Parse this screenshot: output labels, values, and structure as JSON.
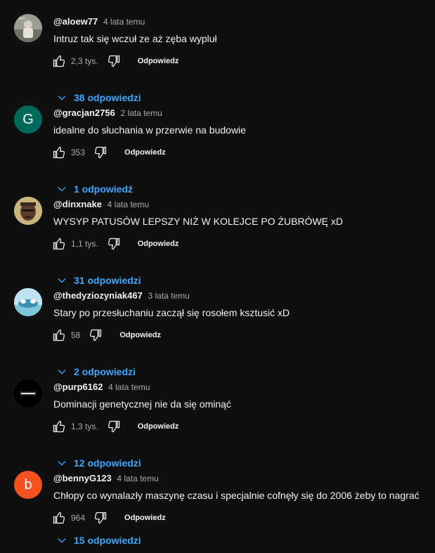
{
  "comments": [
    {
      "author": "@aloew77",
      "time": "4 lata temu",
      "text": "Intruz tak się wczuł ze aż zęba wypluł",
      "likes": "2,3 tys.",
      "reply_label": "Odpowiedz",
      "replies_label": "38 odpowiedzi",
      "avatar": {
        "type": "photo",
        "bg": "#8a8a7a"
      }
    },
    {
      "author": "@gracjan2756",
      "time": "2 lata temu",
      "text": "idealne do słuchania w przerwie na budowie",
      "likes": "353",
      "reply_label": "Odpowiedz",
      "replies_label": "1 odpowiedź",
      "avatar": {
        "type": "letter",
        "letter": "G",
        "bg": "#00695c"
      }
    },
    {
      "author": "@dinxnake",
      "time": "4 lata temu",
      "text": "WYSYP PATUSÓW LEPSZY NIŻ W KOLEJCE PO ŻUBRÓWĘ xD",
      "likes": "1,1 tys.",
      "reply_label": "Odpowiedz",
      "replies_label": "31 odpowiedzi",
      "avatar": {
        "type": "photo",
        "bg": "#c9b27a"
      }
    },
    {
      "author": "@thedyziozyniak467",
      "time": "3 lata temu",
      "text": "Stary po przesłuchaniu zaczął się rosołem ksztusić xD",
      "likes": "58",
      "reply_label": "Odpowiedz",
      "replies_label": "2 odpowiedzi",
      "avatar": {
        "type": "photo",
        "bg": "#bfe3ee"
      }
    },
    {
      "author": "@purp6162",
      "time": "4 lata temu",
      "text": "Dominacji genetycznej nie da się ominąć",
      "likes": "1,3 tys.",
      "reply_label": "Odpowiedz",
      "replies_label": "12 odpowiedzi",
      "avatar": {
        "type": "photo",
        "bg": "#000000"
      }
    },
    {
      "author": "@bennyG123",
      "time": "4 lata temu",
      "text": "Chłopy co wynalazły maszynę czasu i specjalnie cofnęły się do 2006 żeby to nagrać",
      "likes": "964",
      "reply_label": "Odpowiedz",
      "replies_label": "15 odpowiedzi",
      "avatar": {
        "type": "letter",
        "letter": "b",
        "bg": "#f4511e"
      }
    }
  ],
  "colors": {
    "background": "#0f0f0f",
    "text": "#f1f1f1",
    "muted": "#aaaaaa",
    "link": "#3ea6ff"
  },
  "icons": {
    "like": "thumbs-up-icon",
    "dislike": "thumbs-down-icon",
    "replies_toggle": "chevron-down-icon"
  }
}
